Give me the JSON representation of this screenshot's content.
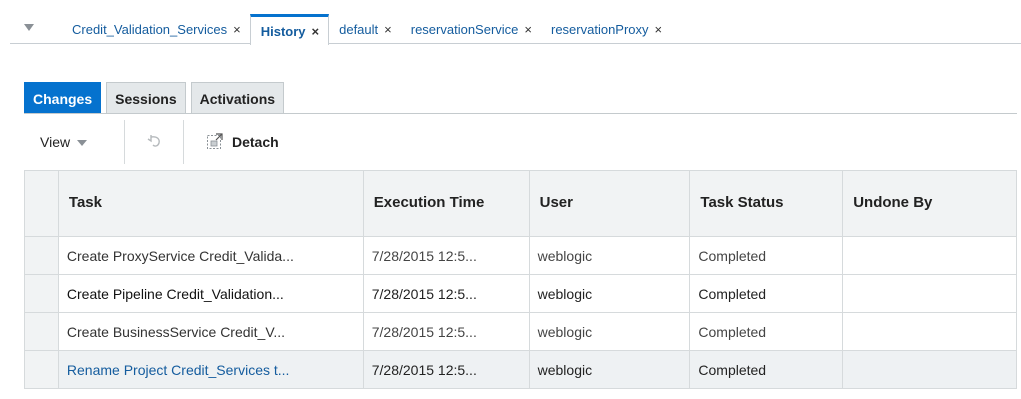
{
  "tabs": [
    {
      "label": "Credit_Validation_Services",
      "close": "×"
    },
    {
      "label": "History",
      "close": "×"
    },
    {
      "label": "default",
      "close": "×"
    },
    {
      "label": "reservationService",
      "close": "×"
    },
    {
      "label": "reservationProxy",
      "close": "×"
    }
  ],
  "subtabs": [
    "Changes",
    "Sessions",
    "Activations"
  ],
  "toolbar": {
    "view_label": "View",
    "detach_label": "Detach"
  },
  "icons": {
    "tab_menu": "triangle-down-icon",
    "view_dropdown": "chevron-down-icon",
    "undo": "undo-icon",
    "detach": "detach-icon"
  },
  "colors": {
    "accent": "#0572ce",
    "link": "#145c9e"
  },
  "table": {
    "columns": [
      "Task",
      "Execution Time",
      "User",
      "Task Status",
      "Undone By"
    ],
    "rows": [
      {
        "task": "Create ProxyService Credit_Valida...",
        "time": "7/28/2015 12:5...",
        "user": "weblogic",
        "status": "Completed",
        "undone_by": ""
      },
      {
        "task": "Create Pipeline Credit_Validation...",
        "time": "7/28/2015 12:5...",
        "user": "weblogic",
        "status": "Completed",
        "undone_by": ""
      },
      {
        "task": "Create BusinessService Credit_V...",
        "time": "7/28/2015 12:5...",
        "user": "weblogic",
        "status": "Completed",
        "undone_by": ""
      },
      {
        "task": "Rename Project Credit_Services t...",
        "time": "7/28/2015 12:5...",
        "user": "weblogic",
        "status": "Completed",
        "undone_by": ""
      }
    ]
  }
}
